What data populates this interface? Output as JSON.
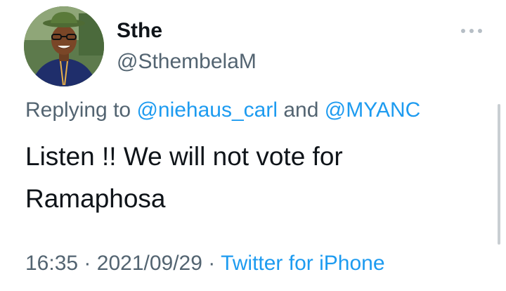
{
  "user": {
    "display_name": "Sthe",
    "handle": "@SthembelaM"
  },
  "reply": {
    "prefix": "Replying to",
    "mention_1": "@niehaus_carl",
    "conjunction": "and",
    "mention_2": "@MYANC"
  },
  "tweet": {
    "line_1": "Listen !! We will not vote for",
    "line_2": "Ramaphosa"
  },
  "meta": {
    "time": "16:35",
    "separator": "·",
    "date": "2021/09/29",
    "source": "Twitter for iPhone"
  },
  "icons": {
    "more": "more-horizontal-icon"
  },
  "colors": {
    "link": "#1d9bf0",
    "secondary_text": "#536471",
    "primary_text": "#0f1419"
  }
}
